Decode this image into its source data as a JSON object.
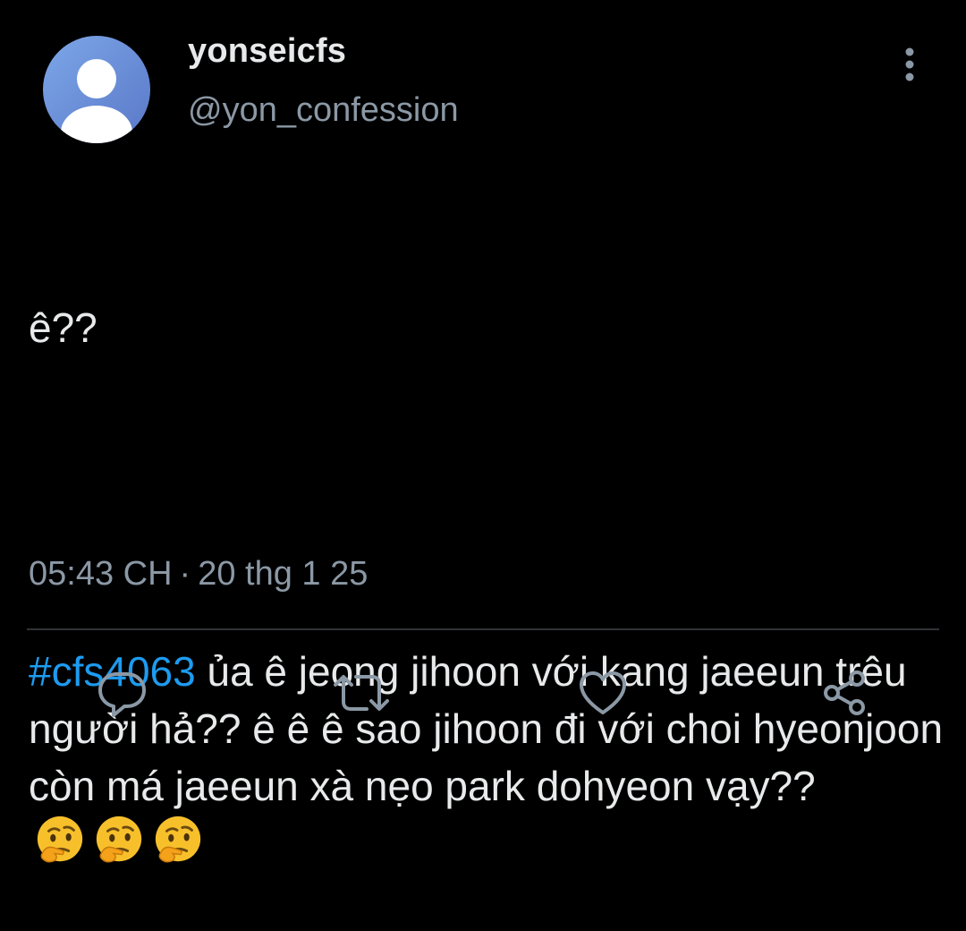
{
  "author": {
    "display_name": "yonseicfs",
    "handle": "@yon_confession"
  },
  "tweet": {
    "line1": "ê??",
    "hashtag": "#cfs4063",
    "body": " ủa ê jeong jihoon với kang jaeeun trêu người hả?? ê ê ê sao jihoon đi với choi hyeonjoon còn má jaeeun xà nẹo park dohyeon vạy?? ",
    "emojis": [
      "thinking-face",
      "thinking-face",
      "thinking-face"
    ]
  },
  "meta": {
    "time": "05:43 CH",
    "separator": "·",
    "date": "20 thg 1 25"
  },
  "actions": {
    "icons": [
      "reply-icon",
      "retweet-icon",
      "like-icon",
      "share-icon"
    ]
  },
  "colors": {
    "background": "#000000",
    "text": "#e7e9ea",
    "secondary": "#8b98a5",
    "hashtag": "#1d9bf0",
    "divider": "#2f3336"
  }
}
